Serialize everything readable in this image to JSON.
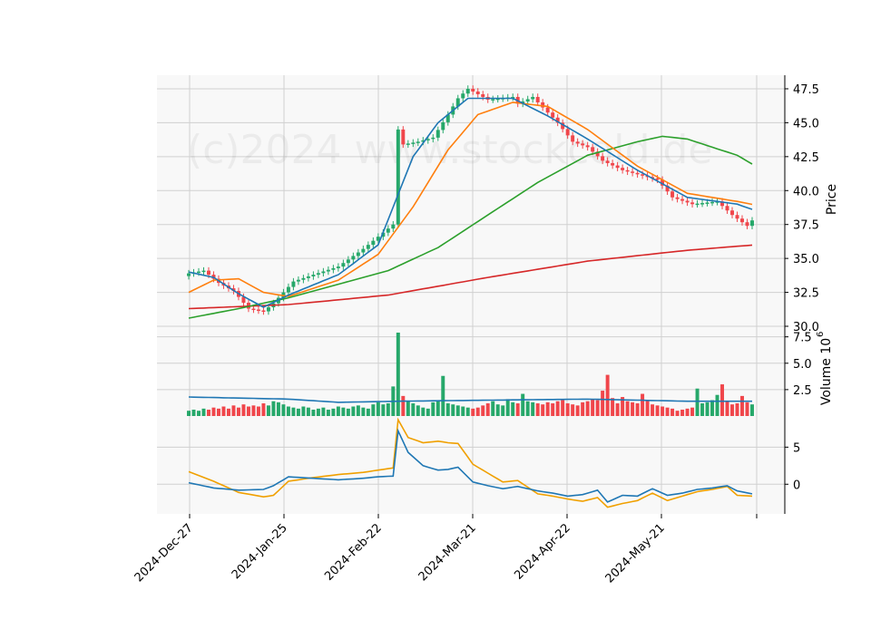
{
  "watermark": "(c)2024 www.stockcold.de",
  "colors": {
    "panel_bg": "#f8f8f8",
    "grid": "#d0d0d0",
    "up": "#26a86a",
    "down": "#f0464b",
    "ma_fast": "#1f77b4",
    "ma_mid": "#ff7f0e",
    "ma_slow": "#2ca02c",
    "ma_long": "#d62728",
    "volume_ma": "#1f77b4",
    "osc_a": "#1f77b4",
    "osc_b": "#f0a000"
  },
  "chart_data": [
    {
      "type": "candlestick",
      "ylabel": "Price",
      "ylim": [
        30.0,
        48.5
      ],
      "y_ticks": [
        "30.0",
        "32.5",
        "35.0",
        "37.5",
        "40.0",
        "42.5",
        "45.0",
        "47.5"
      ],
      "x_tick_labels": [
        "2024-Dec-27",
        "2024-Jan-25",
        "2024-Feb-22",
        "2024-Mar-21",
        "2024-Apr-22",
        "2024-May-21"
      ],
      "x_tick_labels_note": "",
      "close_anchors": [
        [
          0,
          33.9
        ],
        [
          3,
          34.1
        ],
        [
          6,
          33.2
        ],
        [
          9,
          32.6
        ],
        [
          12,
          31.3
        ],
        [
          15,
          31.1
        ],
        [
          17,
          31.7
        ],
        [
          21,
          33.3
        ],
        [
          25,
          33.8
        ],
        [
          30,
          34.4
        ],
        [
          35,
          35.7
        ],
        [
          38,
          36.6
        ],
        [
          41,
          37.5
        ],
        [
          42,
          44.5
        ],
        [
          43,
          43.4
        ],
        [
          46,
          43.6
        ],
        [
          49,
          43.9
        ],
        [
          52,
          45.6
        ],
        [
          54,
          46.8
        ],
        [
          56,
          47.5
        ],
        [
          60,
          46.7
        ],
        [
          65,
          46.9
        ],
        [
          66,
          46.4
        ],
        [
          69,
          46.9
        ],
        [
          70,
          46.5
        ],
        [
          74,
          45.0
        ],
        [
          77,
          43.6
        ],
        [
          80,
          43.2
        ],
        [
          83,
          42.2
        ],
        [
          87,
          41.5
        ],
        [
          90,
          41.2
        ],
        [
          94,
          40.8
        ],
        [
          97,
          39.5
        ],
        [
          101,
          39.0
        ],
        [
          106,
          39.2
        ],
        [
          109,
          38.2
        ],
        [
          112,
          37.4
        ],
        [
          114,
          38.2
        ],
        [
          115,
          36.3
        ],
        [
          117,
          36.9
        ]
      ],
      "ma_fast_anchors": [
        [
          0,
          34.0
        ],
        [
          5,
          33.6
        ],
        [
          10,
          32.4
        ],
        [
          15,
          31.4
        ],
        [
          20,
          32.3
        ],
        [
          30,
          33.8
        ],
        [
          38,
          36.0
        ],
        [
          45,
          42.5
        ],
        [
          50,
          45.0
        ],
        [
          56,
          46.8
        ],
        [
          65,
          46.8
        ],
        [
          72,
          45.5
        ],
        [
          80,
          43.8
        ],
        [
          90,
          41.5
        ],
        [
          100,
          39.5
        ],
        [
          110,
          39.0
        ],
        [
          117,
          38.1
        ]
      ],
      "ma_mid_anchors": [
        [
          0,
          32.5
        ],
        [
          5,
          33.4
        ],
        [
          10,
          33.5
        ],
        [
          15,
          32.5
        ],
        [
          20,
          32.2
        ],
        [
          30,
          33.4
        ],
        [
          38,
          35.3
        ],
        [
          45,
          38.8
        ],
        [
          52,
          43.0
        ],
        [
          58,
          45.6
        ],
        [
          65,
          46.5
        ],
        [
          72,
          46.2
        ],
        [
          80,
          44.5
        ],
        [
          90,
          41.8
        ],
        [
          100,
          39.8
        ],
        [
          110,
          39.2
        ],
        [
          117,
          38.7
        ]
      ],
      "ma_slow_anchors": [
        [
          0,
          30.6
        ],
        [
          10,
          31.3
        ],
        [
          20,
          32.1
        ],
        [
          30,
          33.1
        ],
        [
          40,
          34.1
        ],
        [
          50,
          35.8
        ],
        [
          60,
          38.2
        ],
        [
          70,
          40.6
        ],
        [
          80,
          42.6
        ],
        [
          90,
          43.6
        ],
        [
          95,
          44.0
        ],
        [
          100,
          43.8
        ],
        [
          110,
          42.6
        ],
        [
          117,
          41.1
        ]
      ],
      "ma_long_anchors": [
        [
          0,
          31.3
        ],
        [
          20,
          31.6
        ],
        [
          40,
          32.3
        ],
        [
          60,
          33.6
        ],
        [
          80,
          34.8
        ],
        [
          100,
          35.6
        ],
        [
          117,
          36.1
        ]
      ]
    },
    {
      "type": "bar",
      "ylabel": "Volume",
      "ylabel_exponent": "10",
      "ylabel_exponent_power": "6",
      "ylim": [
        0,
        8.5
      ],
      "y_ticks": [
        "2.5",
        "5.0",
        "7.5"
      ],
      "volume_values": [
        0.5,
        0.6,
        0.5,
        0.7,
        0.6,
        0.8,
        0.7,
        0.9,
        0.7,
        1.0,
        0.8,
        1.1,
        0.9,
        1.0,
        0.9,
        1.2,
        1.0,
        1.4,
        1.3,
        1.1,
        0.9,
        0.8,
        0.7,
        0.9,
        0.8,
        0.6,
        0.7,
        0.8,
        0.6,
        0.7,
        0.9,
        0.8,
        0.7,
        0.9,
        1.0,
        0.8,
        0.7,
        1.1,
        1.3,
        1.1,
        1.2,
        2.8,
        7.9,
        1.9,
        1.4,
        1.2,
        1.0,
        0.8,
        0.7,
        1.3,
        1.5,
        3.8,
        1.2,
        1.1,
        1.0,
        0.9,
        0.8,
        0.7,
        0.8,
        1.0,
        1.2,
        1.4,
        1.1,
        1.0,
        1.6,
        1.3,
        1.2,
        2.1,
        1.4,
        1.3,
        1.2,
        1.1,
        1.3,
        1.2,
        1.4,
        1.5,
        1.2,
        1.1,
        1.0,
        1.3,
        1.4,
        1.6,
        1.5,
        2.4,
        3.9,
        1.7,
        1.2,
        1.8,
        1.4,
        1.3,
        1.2,
        2.1,
        1.5,
        1.1,
        1.0,
        0.9,
        0.8,
        0.7,
        0.5,
        0.6,
        0.7,
        0.8,
        2.6,
        1.2,
        1.3,
        1.5,
        2.0,
        3.0,
        1.4,
        1.1,
        1.2,
        1.9,
        1.3,
        1.1
      ],
      "volume_ma_anchors": [
        [
          0,
          1.8
        ],
        [
          20,
          1.6
        ],
        [
          30,
          1.3
        ],
        [
          42,
          1.4
        ],
        [
          60,
          1.5
        ],
        [
          80,
          1.6
        ],
        [
          100,
          1.4
        ],
        [
          110,
          1.4
        ],
        [
          117,
          1.4
        ]
      ]
    },
    {
      "type": "line",
      "ylabel": "",
      "ylim": [
        -4.0,
        9.2
      ],
      "y_ticks": [
        "0",
        "5"
      ],
      "osc_a_anchors": [
        [
          0,
          0.2
        ],
        [
          5,
          -0.5
        ],
        [
          10,
          -0.8
        ],
        [
          15,
          -0.7
        ],
        [
          17,
          -0.2
        ],
        [
          20,
          1.0
        ],
        [
          25,
          0.8
        ],
        [
          30,
          0.6
        ],
        [
          35,
          0.8
        ],
        [
          38,
          1.0
        ],
        [
          41,
          1.1
        ],
        [
          42,
          7.2
        ],
        [
          44,
          4.3
        ],
        [
          47,
          2.5
        ],
        [
          50,
          1.9
        ],
        [
          52,
          2.0
        ],
        [
          54,
          2.3
        ],
        [
          57,
          0.3
        ],
        [
          60,
          -0.2
        ],
        [
          63,
          -0.6
        ],
        [
          66,
          -0.3
        ],
        [
          70,
          -0.9
        ],
        [
          73,
          -1.2
        ],
        [
          76,
          -1.6
        ],
        [
          79,
          -1.4
        ],
        [
          82,
          -0.8
        ],
        [
          84,
          -2.4
        ],
        [
          87,
          -1.5
        ],
        [
          90,
          -1.6
        ],
        [
          93,
          -0.6
        ],
        [
          96,
          -1.5
        ],
        [
          99,
          -1.2
        ],
        [
          102,
          -0.7
        ],
        [
          105,
          -0.5
        ],
        [
          108,
          -0.2
        ],
        [
          110,
          -0.9
        ],
        [
          113,
          -1.3
        ],
        [
          115,
          -1.7
        ],
        [
          117,
          -1.0
        ]
      ],
      "osc_b_anchors": [
        [
          0,
          1.7
        ],
        [
          5,
          0.4
        ],
        [
          10,
          -1.1
        ],
        [
          15,
          -1.7
        ],
        [
          17,
          -1.5
        ],
        [
          20,
          0.4
        ],
        [
          25,
          0.9
        ],
        [
          30,
          1.3
        ],
        [
          35,
          1.6
        ],
        [
          38,
          1.9
        ],
        [
          41,
          2.2
        ],
        [
          42,
          8.7
        ],
        [
          44,
          6.3
        ],
        [
          47,
          5.6
        ],
        [
          50,
          5.8
        ],
        [
          52,
          5.6
        ],
        [
          54,
          5.5
        ],
        [
          57,
          2.7
        ],
        [
          60,
          1.5
        ],
        [
          63,
          0.3
        ],
        [
          66,
          0.5
        ],
        [
          70,
          -1.3
        ],
        [
          73,
          -1.6
        ],
        [
          76,
          -2.0
        ],
        [
          79,
          -2.3
        ],
        [
          82,
          -1.8
        ],
        [
          84,
          -3.1
        ],
        [
          87,
          -2.6
        ],
        [
          90,
          -2.2
        ],
        [
          93,
          -1.2
        ],
        [
          96,
          -2.2
        ],
        [
          99,
          -1.6
        ],
        [
          102,
          -1.0
        ],
        [
          105,
          -0.7
        ],
        [
          108,
          -0.3
        ],
        [
          110,
          -1.5
        ],
        [
          113,
          -1.6
        ],
        [
          115,
          -2.2
        ],
        [
          117,
          -1.8
        ]
      ]
    }
  ]
}
